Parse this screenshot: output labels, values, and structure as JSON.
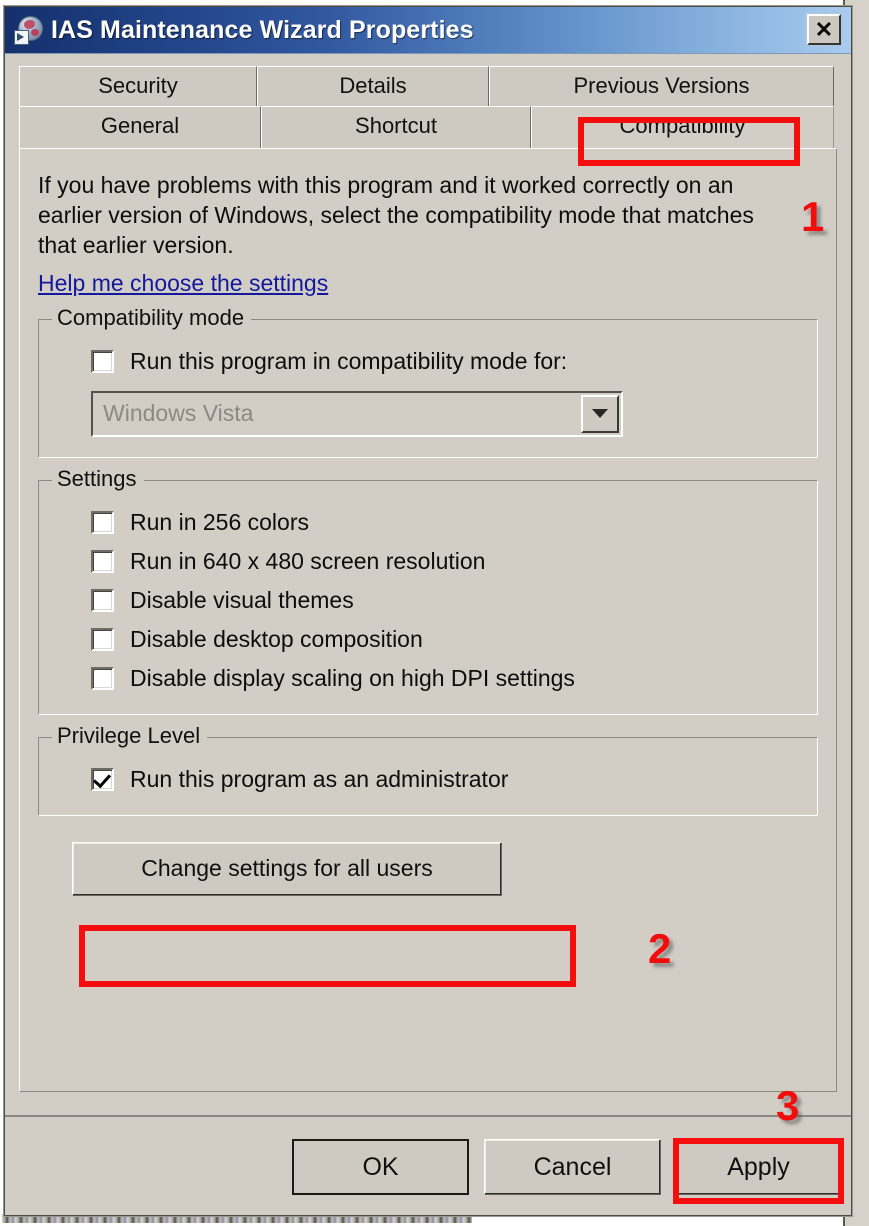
{
  "window": {
    "title": "IAS Maintenance Wizard Properties",
    "icon": "shortcut-globe-icon",
    "close_label": "✕"
  },
  "tabs": {
    "row_top": [
      {
        "label": "Security",
        "active": false
      },
      {
        "label": "Details",
        "active": false
      },
      {
        "label": "Previous Versions",
        "active": false
      }
    ],
    "row_bottom": [
      {
        "label": "General",
        "active": false
      },
      {
        "label": "Shortcut",
        "active": false
      },
      {
        "label": "Compatibility",
        "active": true
      }
    ]
  },
  "content": {
    "intro_text": "If you have problems with this program and it worked correctly on an earlier version of Windows, select the compatibility mode that matches that earlier version.",
    "help_link": "Help me choose the settings",
    "compatibility_mode": {
      "group_title": "Compatibility mode",
      "checkbox_label": "Run this program in compatibility mode for:",
      "checkbox_checked": false,
      "combo_value": "Windows Vista",
      "combo_disabled": true,
      "combo_arrow": "chevron-down-icon"
    },
    "settings": {
      "group_title": "Settings",
      "items": [
        {
          "label": "Run in 256 colors",
          "checked": false
        },
        {
          "label": "Run in 640 x 480 screen resolution",
          "checked": false
        },
        {
          "label": "Disable visual themes",
          "checked": false
        },
        {
          "label": "Disable desktop composition",
          "checked": false
        },
        {
          "label": "Disable display scaling on high DPI settings",
          "checked": false
        }
      ]
    },
    "privilege_level": {
      "group_title": "Privilege Level",
      "checkbox_label": "Run this program as an administrator",
      "checkbox_checked": true
    },
    "change_settings_button": "Change settings for all users"
  },
  "footer": {
    "ok": "OK",
    "cancel": "Cancel",
    "apply": "Apply"
  },
  "annotations": {
    "color": "#f20c0c",
    "steps": [
      {
        "number": "1",
        "target": "Compatibility tab"
      },
      {
        "number": "2",
        "target": "Run this program as an administrator checkbox"
      },
      {
        "number": "3",
        "target": "Apply button"
      }
    ],
    "n1": "1",
    "n2": "2",
    "n3": "3"
  }
}
